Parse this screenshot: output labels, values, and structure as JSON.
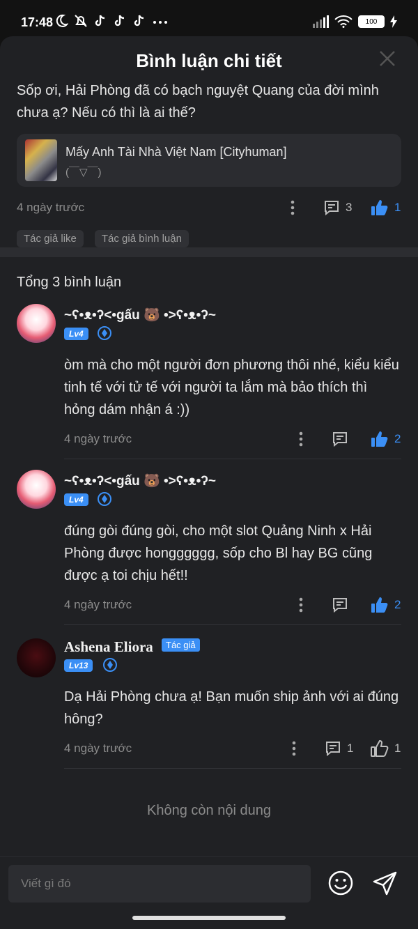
{
  "status_bar": {
    "time": "17:48",
    "left_icons": [
      "moon-icon",
      "bell-off-icon",
      "tiktok-icon",
      "tiktok-icon",
      "tiktok-icon",
      "more-icon"
    ],
    "battery": "100"
  },
  "header": {
    "title": "Bình luận chi tiết"
  },
  "post": {
    "text": "Sốp ơi, Hải Phòng đã có bạch nguyệt Quang của đời mình chưa ạ? Nếu có thì là ai thế?",
    "card": {
      "title": "Mấy Anh Tài Nhà Việt Nam [Cityhuman]",
      "subtitle": "(￣▽￣)"
    },
    "time": "4 ngày trước",
    "reply_count": "3",
    "like_count": "1",
    "tags": [
      "Tác giả like",
      "Tác giả bình luận"
    ]
  },
  "total": "Tổng 3 bình luận",
  "comments": [
    {
      "username": "~ʕ•ᴥ•ʔ<•gấu 🐻 •>ʕ•ᴥ•ʔ~",
      "level": "Lv4",
      "text": "òm mà cho một người đơn phương thôi nhé, kiểu kiểu tinh tế với tử tế với người ta lắm mà bảo thích thì hỏng dám nhận á :))",
      "time": "4 ngày trước",
      "like_count": "2"
    },
    {
      "username": "~ʕ•ᴥ•ʔ<•gấu 🐻 •>ʕ•ᴥ•ʔ~",
      "level": "Lv4",
      "text": "đúng gòi đúng gòi, cho một slot Quảng Ninh x Hải Phòng được hongggggg, sốp cho Bl hay BG cũng được ạ toi chịu hết!!",
      "time": "4 ngày trước",
      "like_count": "2"
    },
    {
      "username": "Ashena Eliora",
      "badge": "Tác giả",
      "level": "Lv13",
      "text": "Dạ Hải Phòng chưa ạ! Bạn muốn ship ảnh với ai đúng hông?",
      "time": "4 ngày trước",
      "reply_count": "1",
      "like_count": "1"
    }
  ],
  "end_text": "Không còn nội dung",
  "composer": {
    "placeholder": "Viết gì đó"
  },
  "colors": {
    "accent": "#3b8ff5",
    "sheet_bg": "#202124",
    "page_bg": "#121212"
  }
}
